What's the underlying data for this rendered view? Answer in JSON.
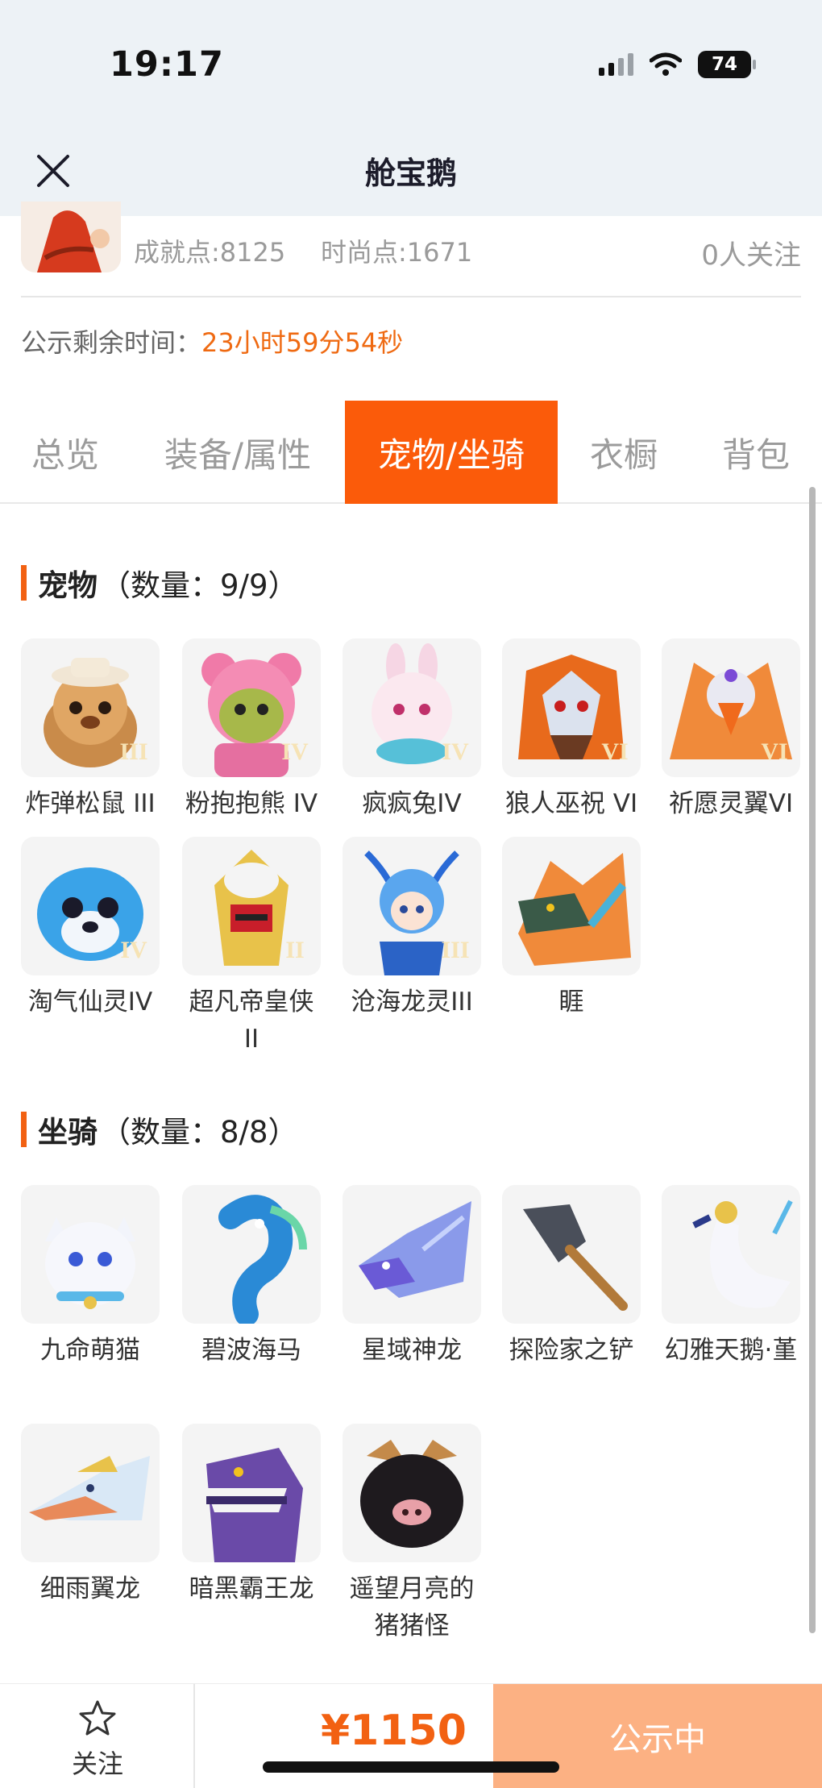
{
  "status_bar": {
    "time": "19:17",
    "battery": "74"
  },
  "header": {
    "title": "舱宝鹅"
  },
  "profile": {
    "achievement": "成就点:8125",
    "fashion": "时尚点:1671",
    "followers": "0人关注"
  },
  "countdown": {
    "label": "公示剩余时间：",
    "value": "23小时59分54秒"
  },
  "tabs": [
    {
      "label": "总览"
    },
    {
      "label": "装备/属性"
    },
    {
      "label": "宠物/坐骑"
    },
    {
      "label": "衣橱"
    },
    {
      "label": "背包"
    }
  ],
  "active_tab": "宠物/坐骑",
  "pets": {
    "title": "宠物",
    "count": "（数量：9/9）",
    "items": [
      {
        "name": "炸弹松鼠 III",
        "badge": "III",
        "icon": "squirrel-pet"
      },
      {
        "name": "粉抱抱熊 IV",
        "badge": "IV",
        "icon": "pink-bear-pet"
      },
      {
        "name": "疯疯兔IV",
        "badge": "IV",
        "icon": "rabbit-pet"
      },
      {
        "name": "狼人巫祝 VI",
        "badge": "VI",
        "icon": "werewolf-pet"
      },
      {
        "name": "祈愿灵翼VI",
        "badge": "VI",
        "icon": "spirit-bird-pet"
      },
      {
        "name": "淘气仙灵IV",
        "badge": "IV",
        "icon": "blue-dog-pet"
      },
      {
        "name": "超凡帝皇侠 II",
        "badge": "II",
        "icon": "golden-knight-pet"
      },
      {
        "name": "沧海龙灵III",
        "badge": "III",
        "icon": "dragon-girl-pet"
      },
      {
        "name": "睚",
        "badge": "",
        "icon": "fire-dragon-pet"
      }
    ]
  },
  "mounts": {
    "title": "坐骑",
    "count": "（数量：8/8）",
    "items": [
      {
        "name": "九命萌猫",
        "icon": "white-cat-mount"
      },
      {
        "name": "碧波海马",
        "icon": "seahorse-mount"
      },
      {
        "name": "星域神龙",
        "icon": "star-dragon-mount"
      },
      {
        "name": "探险家之铲",
        "icon": "shovel-mount"
      },
      {
        "name": "幻雅天鹅·堇",
        "icon": "swan-mount"
      },
      {
        "name": "细雨翼龙",
        "icon": "pterosaur-mount"
      },
      {
        "name": "暗黑霸王龙",
        "icon": "t-rex-mount"
      },
      {
        "name": "遥望月亮的猪猪怪",
        "icon": "pig-mount"
      }
    ]
  },
  "bottom_bar": {
    "follow_label": "关注",
    "price": "¥1150",
    "status": "公示中"
  },
  "colors": {
    "accent": "#fb5b0a",
    "countdown": "#ef6a12",
    "status_button": "#fcb183"
  }
}
